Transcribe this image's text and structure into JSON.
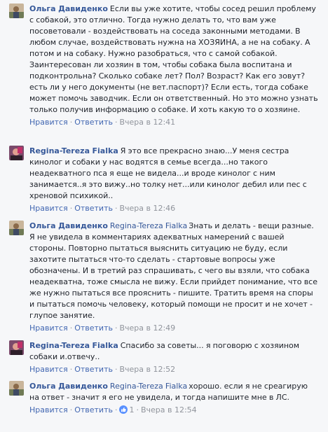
{
  "actions": {
    "like": "Нравится",
    "reply": "Ответить",
    "separator": "·"
  },
  "comments": [
    {
      "author": "Ольга Давиденко",
      "mention": "",
      "text": "Если вы уже хотите, чтобы сосед решил проблему с собакой, это отлично. Тогда нужно делать то, что вам уже посоветовали - воздействовать на соседа законными методами. В любом случае, воздействовать нужна на ХОЗЯИНА, а не на собаку. А потом и на собаку. Нужно разобраться, что с самой собакой. Заинтересован ли хозяин в том, чтобы собака была воспитана и подконтрольна? Сколько собаке лет? Пол? Возраст? Как его зовут? есть ли у него документы (не вет.паспорт)? Если есть, тогда собаке может помочь заводчик. Если он ответственный. Но это можно узнать только получив информацию о собаке. И хоть какую то о хозяине.",
      "time": "Вчера в 12:41"
    },
    {
      "author": "Regina-Tereza Fialka",
      "mention": "",
      "text": "Я это все прекрасно знаю...У меня сестра кинолог и собаки у нас водятся в семье всегда...но такого неадекватного пса я еще не видела...и вроде кинолог с ним занимается..я это вижу..но толку нет...или кинолог дебил или пес с хреновой психикой..",
      "time": "Вчера в 12:46"
    },
    {
      "author": "Ольга Давиденко",
      "mention": "Regina-Tereza Fialka",
      "text": "Знать и делать - вещи разные. Я не увидела в комментариях адекватных намерений с вашей стороны. Повторно пытаться выяснить ситуацию не буду, если захотите пытаться что-то сделать - стартовые вопросы уже обозначены. И в третий раз спрашивать, с чего вы взяли, что собака неадекватна, тоже смысла не вижу. Если прийдет понимание, что все же нужно пытаться все прояснить - пишите. Тратить время на споры и пытаться помочь человеку, который помощи не просит и не хочет - глупое занятие.",
      "time": "Вчера в 12:49"
    },
    {
      "author": "Regina-Tereza Fialka",
      "mention": "",
      "text": "Спасибо за советы... я поговорю с хозяином собаки и.отвечу..",
      "time": "Вчера в 12:52"
    },
    {
      "author": "Ольга Давиденко",
      "mention": "Regina-Tereza Fialka",
      "text": "хорошо. если я не среагирую на ответ - значит я его не увидела, и тогда напишите мне в ЛС.",
      "time": "Вчера в 12:54",
      "reaction_count": "1"
    }
  ],
  "colors": {
    "background": "#f6f7f9",
    "author": "#365899",
    "action_link": "#4267b2",
    "meta": "#90949c",
    "like_badge": "#5890ff"
  }
}
